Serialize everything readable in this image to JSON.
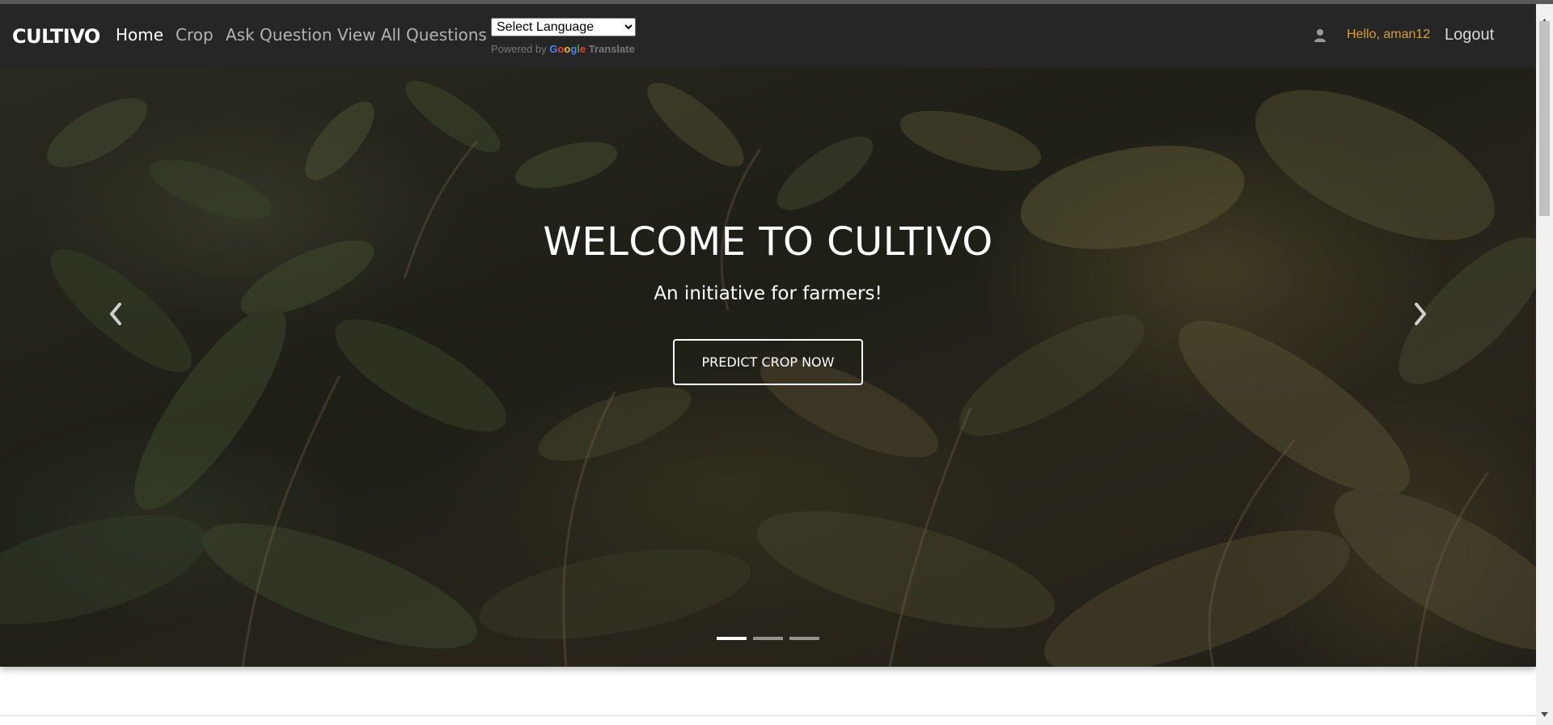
{
  "navbar": {
    "brand": "CULTIVO",
    "links": [
      {
        "label": "Home",
        "active": true
      },
      {
        "label": "Crop",
        "active": false
      },
      {
        "label": "Ask Question",
        "active": false
      },
      {
        "label": "View All Questions",
        "active": false
      }
    ],
    "language_select": {
      "selected": "Select Language"
    },
    "powered_by": {
      "prefix": "Powered by",
      "brand": "Google",
      "suffix": "Translate"
    },
    "user": {
      "icon": "user-icon",
      "greeting": "Hello, aman12",
      "logout": "Logout"
    }
  },
  "hero": {
    "title": "WELCOME TO CULTIVO",
    "subtitle": "An initiative for farmers!",
    "cta": "PREDICT CROP NOW",
    "prev_icon": "chevron-left-icon",
    "next_icon": "chevron-right-icon",
    "slides": 3,
    "active_slide": 1
  },
  "colors": {
    "navbar_bg": "#262626",
    "greeting": "#d8a02e",
    "nav_inactive": "#b3b3b3"
  }
}
